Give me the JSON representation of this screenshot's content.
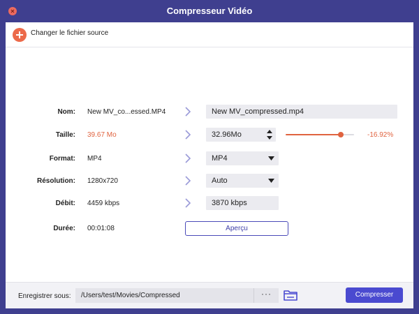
{
  "window": {
    "title": "Compresseur Vidéo"
  },
  "source": {
    "label": "Changer le fichier source"
  },
  "rows": {
    "name": {
      "label": "Nom:",
      "source": "New MV_co...essed.MP4",
      "target": "New MV_compressed.mp4"
    },
    "size": {
      "label": "Taille:",
      "source": "39.67 Mo",
      "target": "32.96Mo",
      "percent": "-16.92%",
      "slider_fraction": 0.83
    },
    "format": {
      "label": "Format:",
      "source": "MP4",
      "target": "MP4"
    },
    "resolution": {
      "label": "Résolution:",
      "source": "1280x720",
      "target": "Auto"
    },
    "bitrate": {
      "label": "Débit:",
      "source": "4459 kbps",
      "target": "3870 kbps"
    },
    "duration": {
      "label": "Durée:",
      "source": "00:01:08"
    }
  },
  "preview": {
    "label": "Aperçu"
  },
  "footer": {
    "save_label": "Enregistrer sous:",
    "path": "/Users/test/Movies/Compressed",
    "more_label": "···",
    "compress_label": "Compresser"
  },
  "colors": {
    "titlebar": "#3f3f8f",
    "accent": "#e0633f",
    "primary": "#4a4ad0"
  }
}
